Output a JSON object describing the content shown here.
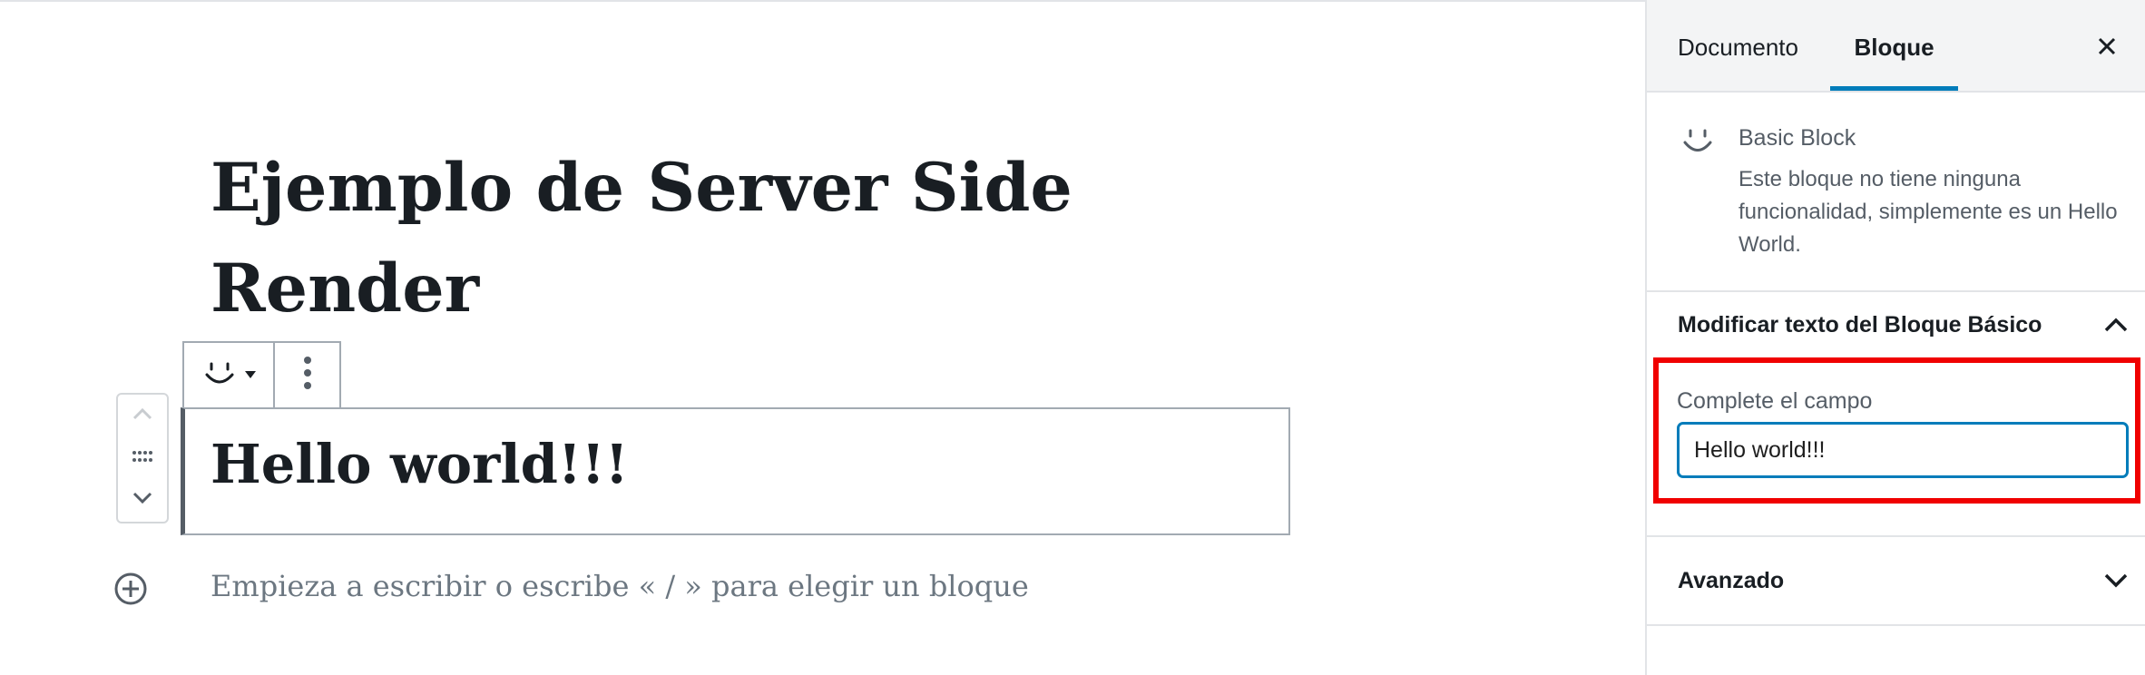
{
  "editor": {
    "post_title": "Ejemplo de Server Side Render",
    "block_content": "Hello world!!!",
    "appender_placeholder": "Empieza a escribir o escribe « / » para elegir un bloque"
  },
  "sidebar": {
    "tabs": [
      {
        "label": "Documento",
        "active": false
      },
      {
        "label": "Bloque",
        "active": true
      }
    ],
    "close_icon": "close-icon",
    "block_card": {
      "icon": "smiley-icon",
      "title": "Basic Block",
      "description": "Este bloque no tiene ninguna funcionalidad, simplemente es un Hello World."
    },
    "panels": {
      "modify": {
        "title": "Modificar texto del Bloque Básico",
        "expanded": true,
        "field_label": "Complete el campo",
        "field_value": "Hello world!!!"
      },
      "advanced": {
        "title": "Avanzado",
        "expanded": false
      }
    }
  },
  "colors": {
    "accent": "#007cba",
    "highlight": "#f00000",
    "text": "#191e23",
    "muted": "#555d66"
  }
}
